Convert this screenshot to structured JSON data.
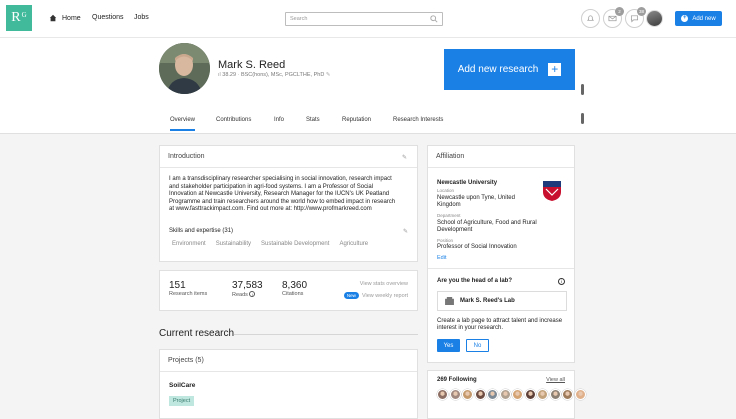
{
  "nav": {
    "logo": "R",
    "logo_sup": "G",
    "home": "Home",
    "questions": "Questions",
    "jobs": "Jobs",
    "search_placeholder": "Search",
    "badge_1": "2",
    "badge_2": "38",
    "add_new": "Add new"
  },
  "profile": {
    "name": "Mark S. Reed",
    "score": "38.29",
    "degrees": "BSC(hons), MSc, PGCLTHE, PhD",
    "add_research": "Add new research"
  },
  "tabs": [
    "Overview",
    "Contributions",
    "Info",
    "Stats",
    "Reputation",
    "Research Interests"
  ],
  "intro": {
    "title": "Introduction",
    "lines": [
      "I am a transdisciplinary researcher specialising in social innovation, research impact",
      "and stakeholder participation in agri-food systems. I am a Professor of Social",
      "Innovation at Newcastle University, Research Manager for the IUCN's UK Peatland",
      "Programme and train researchers around the world how to embed impact in research",
      "at www.fasttrackimpact.com. Find out more at: http://www.profmarkreed.com"
    ],
    "skills_title": "Skills and expertise (31)",
    "skills": [
      "Environment",
      "Sustainability",
      "Sustainable Development",
      "Agriculture"
    ]
  },
  "stats": {
    "research_items_n": "151",
    "research_items_l": "Research items",
    "reads_n": "37,583",
    "reads_l": "Reads",
    "citations_n": "8,360",
    "citations_l": "Citations",
    "view_stats": "View stats overview",
    "new_badge": "New",
    "view_weekly": "View weekly report"
  },
  "current": {
    "title": "Current research",
    "projects": "Projects (5)",
    "project_name": "SoilCare",
    "project_tag": "Project"
  },
  "affiliation": {
    "title": "Affiliation",
    "institution": "Newcastle University",
    "location_label": "Location",
    "location": [
      "Newcastle upon Tyne, United",
      "Kingdom"
    ],
    "department_label": "Department",
    "department": [
      "School of Agriculture, Food and Rural",
      "Development"
    ],
    "position_label": "Position",
    "position": "Professor of Social Innovation",
    "edit": "Edit"
  },
  "lab": {
    "question": "Are you the head of a lab?",
    "lab_name": "Mark S. Reed's Lab",
    "desc": [
      "Create a lab page to attract talent and increase",
      "interest in your research."
    ],
    "yes": "Yes",
    "no": "No"
  },
  "following": {
    "title": "269 Following",
    "view_all": "View all",
    "avatar_colors": [
      "#8d6e63",
      "#a1887f",
      "#c49a6c",
      "#6d4c41",
      "#7d8a96",
      "#b0a090",
      "#d4a373",
      "#5d4037",
      "#c2a27a",
      "#8a7f72",
      "#9e7b5a",
      "#e0b08a"
    ]
  }
}
